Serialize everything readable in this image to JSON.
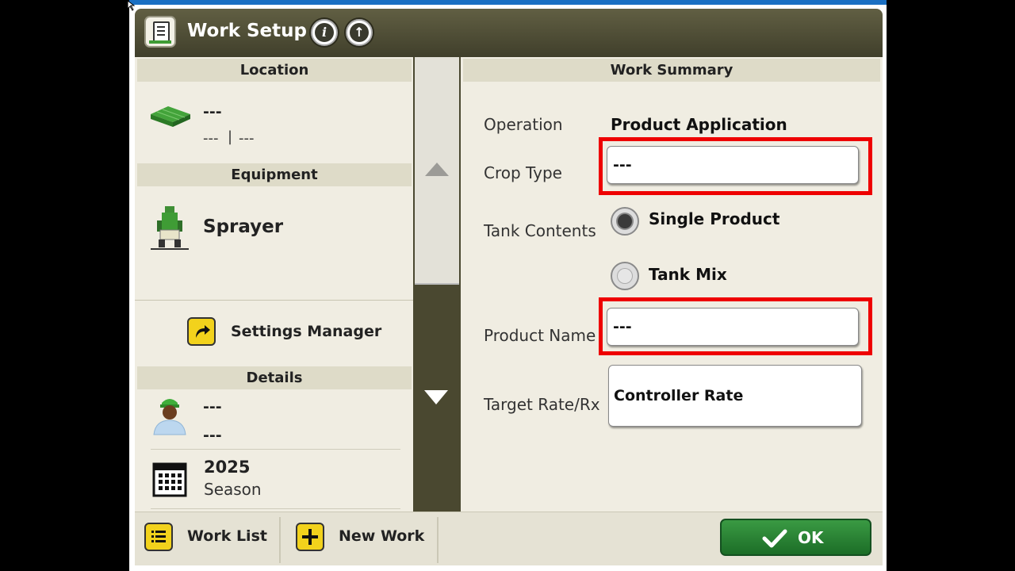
{
  "window": {
    "title": "Work Setup"
  },
  "header_buttons": {
    "info_label": "i",
    "up_label": "↑"
  },
  "left": {
    "location": {
      "header": "Location",
      "name": "---",
      "sub_a": "---",
      "sep": "|",
      "sub_b": "---"
    },
    "equipment": {
      "header": "Equipment",
      "name": "Sprayer"
    },
    "settings_manager": {
      "label": "Settings Manager"
    },
    "details": {
      "header": "Details",
      "operator_line1": "---",
      "operator_line2": "---",
      "season_value": "2025",
      "season_label": "Season"
    }
  },
  "right": {
    "header": "Work Summary",
    "operation": {
      "label": "Operation",
      "value": "Product Application"
    },
    "crop_type": {
      "label": "Crop Type",
      "value": "---"
    },
    "tank_contents": {
      "label": "Tank Contents",
      "options": [
        "Single Product",
        "Tank Mix"
      ],
      "selected": "Single Product"
    },
    "product_name": {
      "label": "Product Name",
      "value": "---"
    },
    "target_rate": {
      "label": "Target Rate/Rx",
      "value": "Controller Rate"
    }
  },
  "footer": {
    "work_list": "Work List",
    "new_work": "New Work",
    "ok": "OK"
  },
  "colors": {
    "highlight": "#ee0000",
    "accent_green": "#3f9c35",
    "button_yellow": "#f2d21c",
    "titlebar": "#4f4d36"
  }
}
